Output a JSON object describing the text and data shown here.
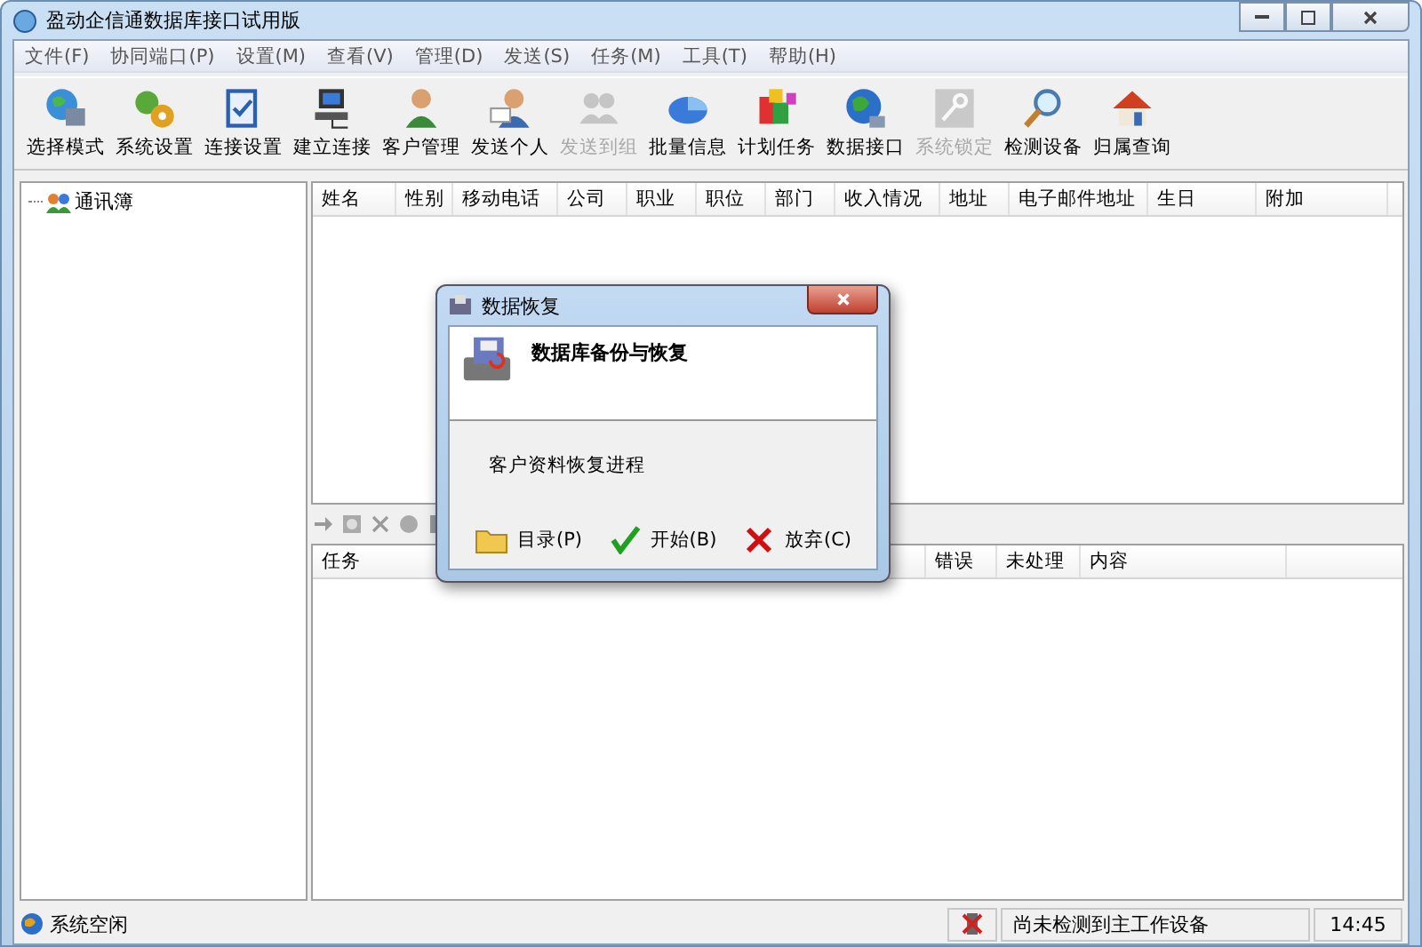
{
  "window": {
    "title": "盈动企信通数据库接口试用版"
  },
  "menu": [
    "文件(F)",
    "协同端口(P)",
    "设置(M)",
    "查看(V)",
    "管理(D)",
    "发送(S)",
    "任务(M)",
    "工具(T)",
    "帮助(H)"
  ],
  "toolbar": [
    {
      "label": "选择模式",
      "disabled": false
    },
    {
      "label": "系统设置",
      "disabled": false
    },
    {
      "label": "连接设置",
      "disabled": false
    },
    {
      "label": "建立连接",
      "disabled": false
    },
    {
      "label": "客户管理",
      "disabled": false
    },
    {
      "label": "发送个人",
      "disabled": false
    },
    {
      "label": "发送到组",
      "disabled": true
    },
    {
      "label": "批量信息",
      "disabled": false
    },
    {
      "label": "计划任务",
      "disabled": false
    },
    {
      "label": "数据接口",
      "disabled": false
    },
    {
      "label": "系统锁定",
      "disabled": true
    },
    {
      "label": "检测设备",
      "disabled": false
    },
    {
      "label": "归属查询",
      "disabled": false
    }
  ],
  "tree": {
    "items": [
      {
        "label": "通讯簿",
        "expanded": false
      }
    ]
  },
  "contacts_table": {
    "columns": [
      "姓名",
      "性别",
      "移动电话",
      "公司",
      "职业",
      "职位",
      "部门",
      "收入情况",
      "地址",
      "电子邮件地址",
      "生日",
      "附加"
    ]
  },
  "tasks_table": {
    "columns": [
      "任务",
      "错误",
      "未处理",
      "内容"
    ]
  },
  "dialog": {
    "title": "数据恢复",
    "heading": "数据库备份与恢复",
    "message": "客户资料恢复进程",
    "buttons": [
      "目录(P)",
      "开始(B)",
      "放弃(C)"
    ]
  },
  "status_bar": {
    "state": "系统空闲",
    "device": "尚未检测到主工作设备",
    "time": "14:45"
  }
}
